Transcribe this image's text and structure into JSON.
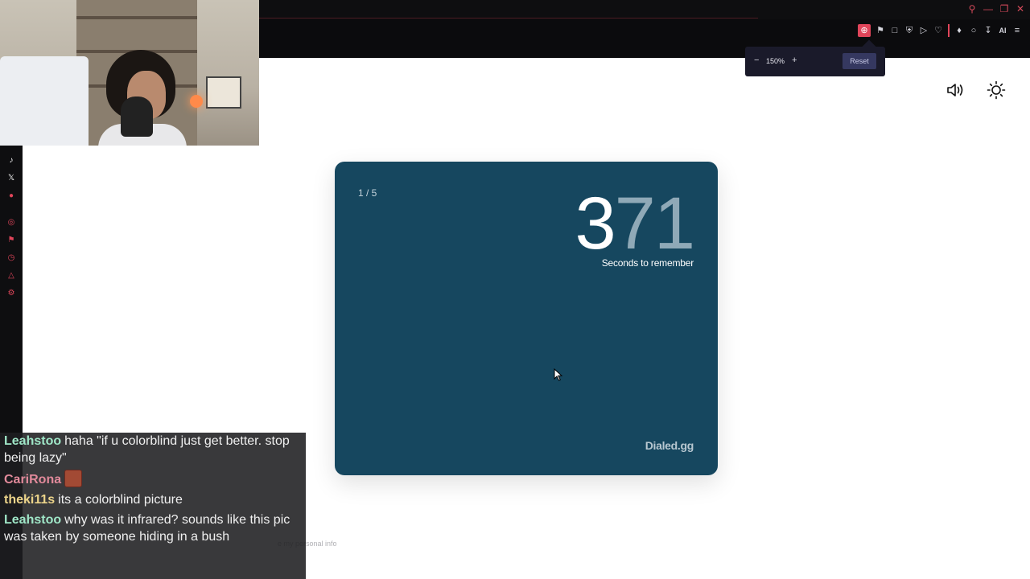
{
  "zoom": {
    "level": "150%",
    "minus": "−",
    "plus": "+",
    "reset_label": "Reset"
  },
  "toolbar": {
    "icons": [
      "zoom-icon",
      "bookmark-icon",
      "screenshot-icon",
      "shield-icon",
      "play-icon",
      "heart-icon",
      "puzzle-icon",
      "profile-icon",
      "download-icon",
      "ai-icon",
      "menu-icon"
    ],
    "ai_label": "AI"
  },
  "window_controls": [
    "search-icon",
    "minimize-icon",
    "restore-icon",
    "close-icon"
  ],
  "sidebar": {
    "icons": [
      "tiktok-icon",
      "x-icon",
      "weibo-icon",
      "target-icon",
      "pin-icon",
      "clock-icon",
      "cube-icon",
      "settings-icon"
    ]
  },
  "page": {
    "speaker_icon": "speaker-icon",
    "theme_icon": "sun-icon",
    "privacy_text": "e my personal info"
  },
  "game": {
    "round": "1 / 5",
    "timer_first_digit": "3",
    "timer_rest_digits": "71",
    "timer_label": "Seconds to remember",
    "brand": "Dialed.gg",
    "card_color": "#16475f"
  },
  "chat": {
    "messages": [
      {
        "user": "Leahstoo",
        "text": "haha \"if u colorblind just get better. stop being lazy\"",
        "color": "#9fe6c7"
      },
      {
        "user": "CariRona",
        "text": "",
        "emote": true,
        "color": "#e28a9b"
      },
      {
        "user": "theki11s",
        "text": "its a colorblind picture",
        "color": "#ecd48a"
      },
      {
        "user": "Leahstoo",
        "text": "why was it infrared? sounds like this pic was taken by someone hiding in a bush",
        "color": "#9fe6c7"
      }
    ]
  },
  "colors": {
    "accent": "#e0455a",
    "chrome_bg": "#0b0b0d"
  }
}
